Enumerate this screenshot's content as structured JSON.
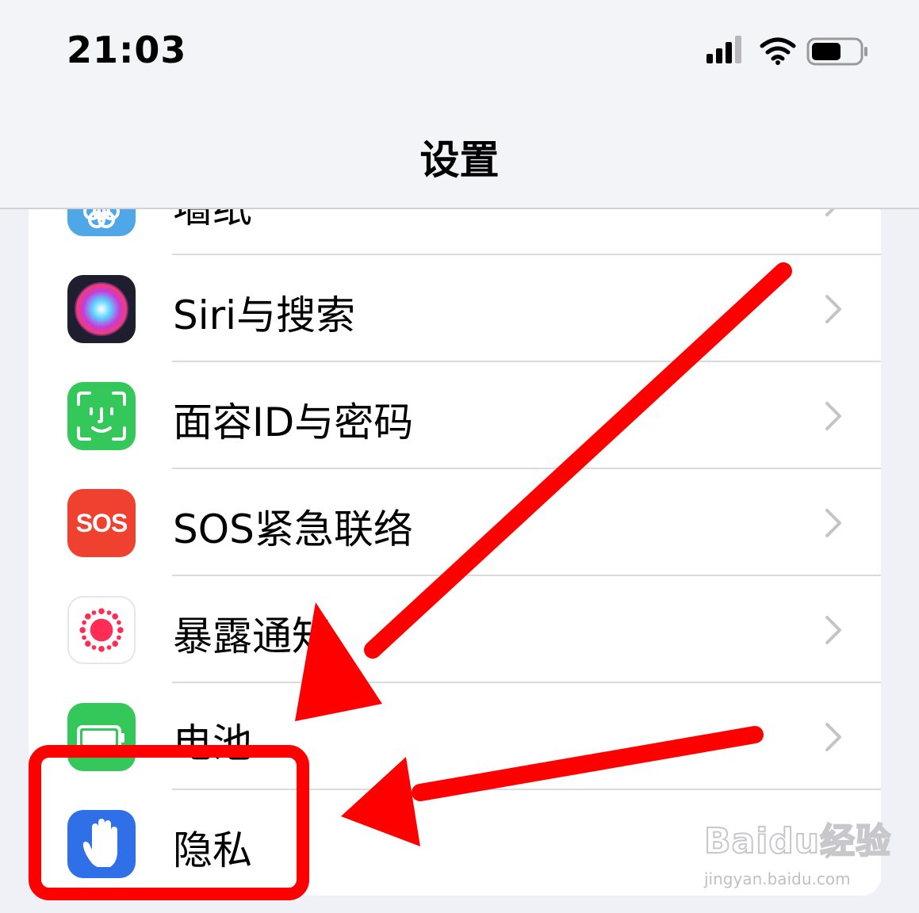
{
  "status_bar": {
    "time": "21:03",
    "signal_icon": "cellular-signal-icon",
    "wifi_icon": "wifi-icon",
    "battery_icon": "battery-icon"
  },
  "nav": {
    "title": "设置"
  },
  "settings": {
    "items": [
      {
        "label": "墙纸",
        "icon": "wallpaper-icon",
        "icon_color": "#4fa7e8"
      },
      {
        "label": "Siri与搜索",
        "icon": "siri-icon",
        "icon_color": "#222244"
      },
      {
        "label": "面容ID与密码",
        "icon": "face-id-icon",
        "icon_color": "#34c759"
      },
      {
        "label": "SOS紧急联络",
        "icon": "sos-icon",
        "icon_color": "#f0402f",
        "icon_text": "SOS"
      },
      {
        "label": "暴露通知",
        "icon": "exposure-notification-icon",
        "icon_color": "#ff2d55"
      },
      {
        "label": "电池",
        "icon": "battery-app-icon",
        "icon_color": "#34c759"
      },
      {
        "label": "隐私",
        "icon": "privacy-hand-icon",
        "icon_color": "#2f6fe8"
      }
    ]
  },
  "annotation": {
    "color": "#ff0000"
  },
  "watermark": {
    "brand": "Baidu经验",
    "url": "jingyan.baidu.com"
  }
}
